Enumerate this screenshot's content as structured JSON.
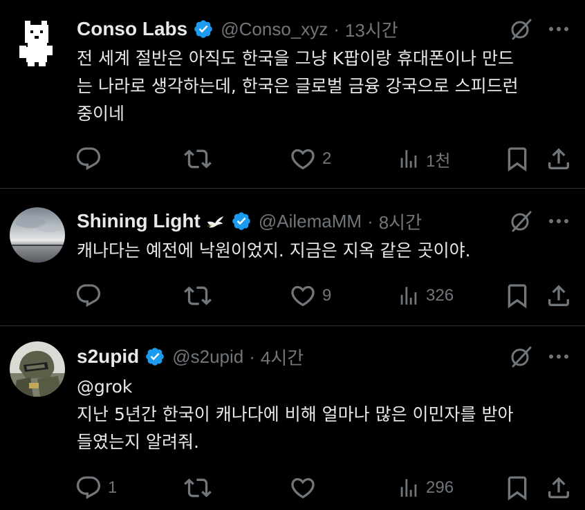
{
  "tweets": [
    {
      "name": "Conso Labs",
      "handle": "@Conso_xyz",
      "dot": "·",
      "time": "13시간",
      "body": [
        "전 세계 절반은 아직도 한국을 그냥 K팝이랑 휴대폰이나 만드",
        "는 나라로 생각하는데, 한국은 글로벌 금융 강국으로 스피드런",
        "중이네"
      ],
      "reply_count": "",
      "retweet_count": "",
      "like_count": "2",
      "views_count": "1천",
      "verified": true,
      "avatar_icon": "pixel-bear-icon"
    },
    {
      "name": "Shining Light",
      "handle": "@AilemaMM",
      "dot": "·",
      "time": "8시간",
      "body": [
        "캐나다는 예전에 낙원이었지. 지금은 지옥 같은 곳이야."
      ],
      "reply_count": "",
      "retweet_count": "",
      "like_count": "9",
      "views_count": "326",
      "verified": true,
      "name_emoji": "dove-icon",
      "avatar_icon": "sky-photo"
    },
    {
      "name": "s2upid",
      "handle": "@s2upid",
      "dot": "·",
      "time": "4시간",
      "body": [
        "@grok",
        "지난 5년간 한국이 캐나다에 비해 얼마나 많은 이민자를 받아",
        "들였는지 알려줘."
      ],
      "reply_count": "1",
      "retweet_count": "",
      "like_count": "",
      "views_count": "296",
      "verified": true,
      "avatar_icon": "armored-soldier-photo"
    }
  ],
  "colors": {
    "background": "#000000",
    "text_primary": "#e7e9ea",
    "text_secondary": "#71767b",
    "verified_blue": "#1d9bf0",
    "divider": "#2f3336"
  }
}
